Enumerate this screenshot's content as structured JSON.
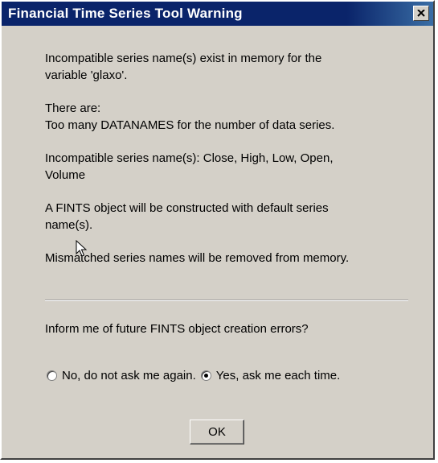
{
  "window": {
    "title": "Financial Time Series Tool Warning",
    "close_icon": "close-icon"
  },
  "message": {
    "para1": [
      "Incompatible series name(s) exist in memory for the",
      "variable 'glaxo'."
    ],
    "para2": [
      "There are:",
      "Too many DATANAMES for the number of data series."
    ],
    "para3": [
      "Incompatible series name(s): Close, High, Low, Open,",
      "Volume"
    ],
    "para4": [
      "A FINTS object will be constructed with default series",
      "name(s)."
    ],
    "para5": "Mismatched series names will be removed from memory."
  },
  "question": "Inform me of future FINTS object creation errors?",
  "options": [
    {
      "label": "No, do not ask me again.",
      "selected": false
    },
    {
      "label": "Yes, ask me each time.",
      "selected": true
    }
  ],
  "ok_label": "OK"
}
